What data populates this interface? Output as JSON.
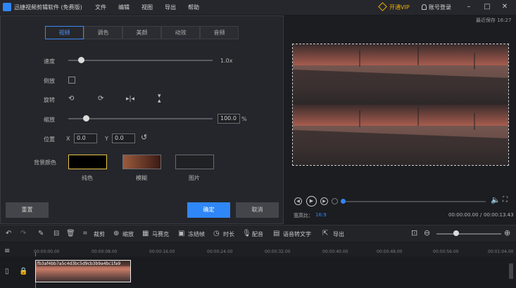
{
  "app": {
    "title": "迅捷视频剪辑软件 (免费版)",
    "menu": [
      "文件",
      "编辑",
      "视图",
      "导出",
      "帮助"
    ],
    "vip": "开通VIP",
    "login": "账号登录",
    "saved": "最近保存 16:27"
  },
  "editor": {
    "tabs": [
      "视频",
      "调色",
      "美颜",
      "动效",
      "音频"
    ],
    "speed": {
      "label": "速度",
      "value": "1.0x",
      "fraction": 0.09
    },
    "reverse": {
      "label": "倒放"
    },
    "rotate": {
      "label": "旋转"
    },
    "scale": {
      "label": "缩放",
      "value": "100.0",
      "unit": "%",
      "fraction": 0.12
    },
    "position": {
      "label": "位置",
      "x_label": "X",
      "x_value": "0.0",
      "y_label": "Y",
      "y_value": "0.0"
    },
    "background": {
      "label": "背景颜色",
      "options": [
        "纯色",
        "模糊",
        "图片"
      ]
    },
    "reset": "重置",
    "ok": "确定",
    "cancel": "取消"
  },
  "preview": {
    "time_current": "00:00:00.00",
    "time_total": "00:00:13.43",
    "ratio_label": "宽高比：",
    "ratio_value": "16:9",
    "progress": 0.0
  },
  "toolbar": {
    "crop": "裁剪",
    "zoom": "缩放",
    "mosaic": "马赛克",
    "freeze": "冻结帧",
    "duration": "时长",
    "dub": "配音",
    "speech": "语音转文字",
    "export": "导出"
  },
  "timeline": {
    "ticks": [
      "00:00:00.00",
      "00:00:08.00",
      "00:00:16.00",
      "00:00:24.00",
      "00:00:32.00",
      "00:00:40.00",
      "00:00:48.00",
      "00:00:56.00",
      "00:01:04.00"
    ],
    "clip_name": "fb3af4bb7a5c4d3bc5d9cb3b9a4bc1fa9"
  },
  "colors": {
    "accent": "#2f86f6",
    "vip": "#f0b000"
  }
}
